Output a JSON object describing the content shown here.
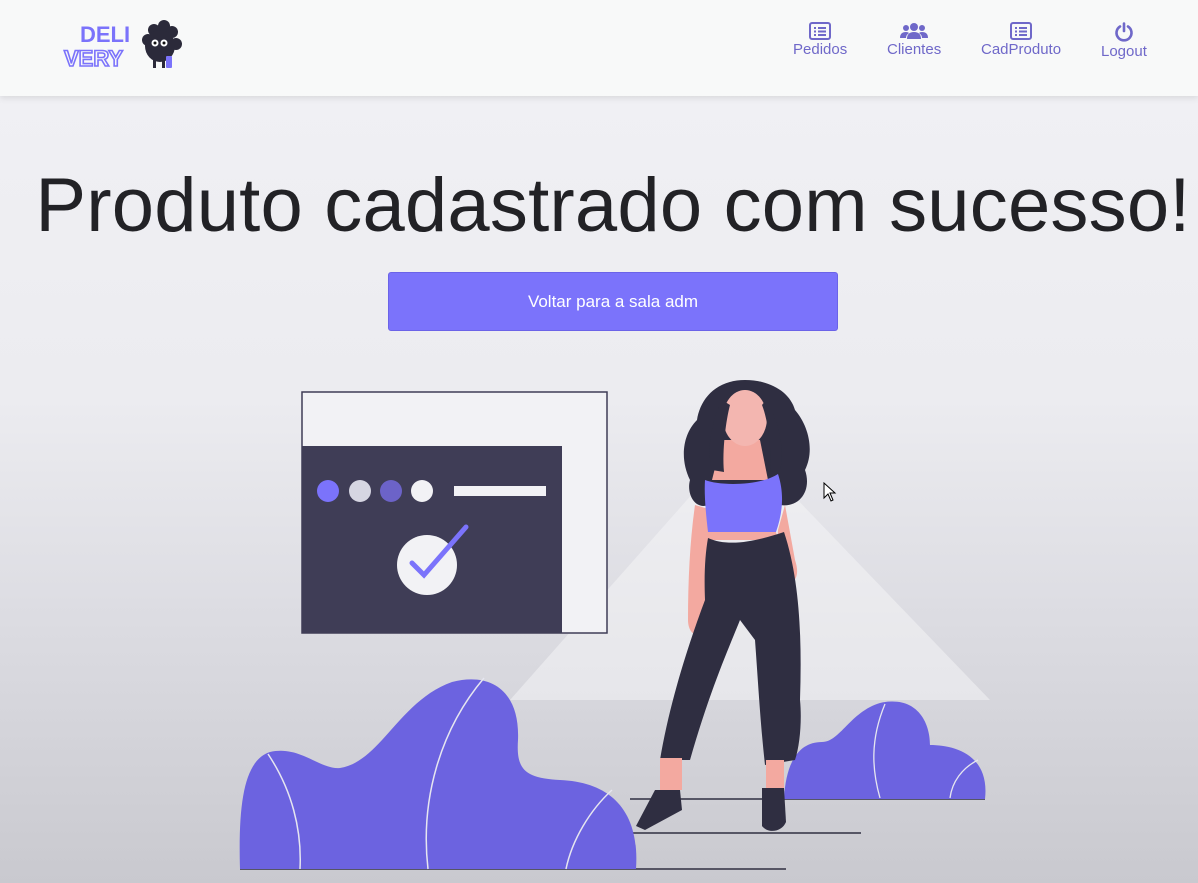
{
  "navbar": {
    "logo": {
      "line1": "DELI",
      "line2": "VERY",
      "icon": "sheep-mascot-icon"
    },
    "links": [
      {
        "label": "Pedidos",
        "icon": "list-icon"
      },
      {
        "label": "Clientes",
        "icon": "users-icon"
      },
      {
        "label": "CadProduto",
        "icon": "list-icon"
      },
      {
        "label": "Logout",
        "icon": "power-icon"
      }
    ]
  },
  "main": {
    "headline": "Produto cadastrado com sucesso!",
    "back_button_label": "Voltar para a sala adm"
  },
  "colors": {
    "accent": "#7b73fb",
    "nav_text": "#6f68c9",
    "dark_panel": "#3f3d56",
    "plant": "#6c63e0"
  }
}
